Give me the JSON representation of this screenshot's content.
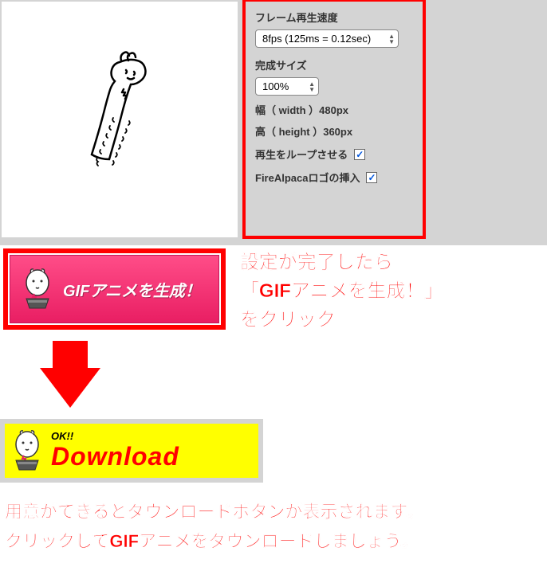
{
  "settings": {
    "fps_label": "フレーム再生速度",
    "fps_value": "8fps (125ms = 0.12sec)",
    "size_label": "完成サイズ",
    "size_value": "100%",
    "width_text": "幅（ width ）480px",
    "height_text": "高（ height ）360px",
    "loop_label": "再生をループさせる",
    "logo_label": "FireAlpacaロゴの挿入"
  },
  "generate": {
    "button_label": "GIFアニメを生成！",
    "instruction": "設定が完了したら\n「GIFアニメを生成！」\nをクリック"
  },
  "download": {
    "ok_label": "OK!!",
    "download_label": "Download",
    "instruction": "用意ができるとダウンロードボタンが表示されます。\nクリックしてGIFアニメをダウンロードしましょう。"
  }
}
